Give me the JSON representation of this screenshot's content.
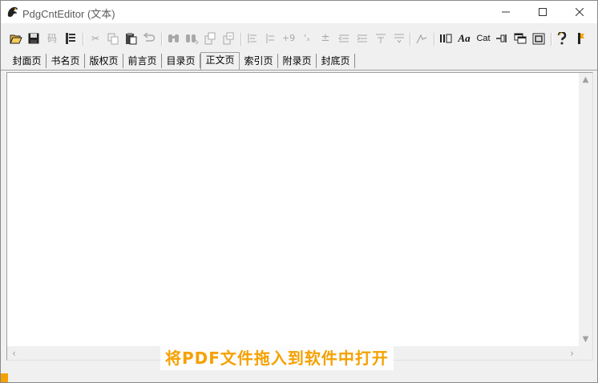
{
  "window": {
    "title": "PdgCntEditor",
    "subtitle": "(文本)"
  },
  "toolbar": {
    "items": [
      {
        "name": "open-icon",
        "glyph": "📂"
      },
      {
        "name": "save-icon",
        "glyph": "💾"
      },
      {
        "name": "code-icon",
        "glyph": "码"
      },
      {
        "name": "bookmark-icon",
        "glyph": "▤"
      },
      {
        "name": "cut-icon",
        "glyph": "✂"
      },
      {
        "name": "copy-icon",
        "glyph": "⧉"
      },
      {
        "name": "paste-icon",
        "glyph": "📋"
      },
      {
        "name": "undo-icon",
        "glyph": "↶"
      },
      {
        "name": "find-icon",
        "glyph": "⁂"
      },
      {
        "name": "find-next-icon",
        "glyph": "⁑"
      },
      {
        "name": "replace-icon",
        "glyph": "⎘"
      },
      {
        "name": "replace-all-icon",
        "glyph": "⎗"
      },
      {
        "name": "align-left-icon",
        "glyph": "≡"
      },
      {
        "name": "indent-icon",
        "glyph": "⊨"
      },
      {
        "name": "number-plus-icon",
        "glyph": "+9"
      },
      {
        "name": "number-format-icon",
        "glyph": "'ₓ"
      },
      {
        "name": "plus-minus-icon",
        "glyph": "±"
      },
      {
        "name": "outdent-icon",
        "glyph": "⇤"
      },
      {
        "name": "indent-more-icon",
        "glyph": "⇥"
      },
      {
        "name": "move-up-icon",
        "glyph": "⊼"
      },
      {
        "name": "move-down-icon",
        "glyph": "⊻"
      },
      {
        "name": "link-icon",
        "glyph": "⅄"
      },
      {
        "name": "columns-icon",
        "glyph": "Ⅲ"
      },
      {
        "name": "font-icon",
        "glyph": "Aa"
      },
      {
        "name": "catalog-icon",
        "glyph": "Cat"
      },
      {
        "name": "pin-icon",
        "glyph": "⊣"
      },
      {
        "name": "window-icon",
        "glyph": "⧉"
      },
      {
        "name": "preview-icon",
        "glyph": "▣"
      },
      {
        "name": "help-icon",
        "glyph": "?"
      },
      {
        "name": "about-icon",
        "glyph": "⚑"
      }
    ]
  },
  "tabs": [
    {
      "label": "封面页"
    },
    {
      "label": "书名页"
    },
    {
      "label": "版权页"
    },
    {
      "label": "前言页"
    },
    {
      "label": "目录页"
    },
    {
      "label": "正文页",
      "active": true
    },
    {
      "label": "索引页"
    },
    {
      "label": "附录页"
    },
    {
      "label": "封底页"
    }
  ],
  "editor": {
    "content": ""
  },
  "caption": {
    "text": "将PDF文件拖入到软件中打开",
    "color": "#f5a100"
  },
  "colors": {
    "accent": "#f5a100",
    "window_bg": "#f0f0f0",
    "editor_bg": "#ffffff"
  }
}
